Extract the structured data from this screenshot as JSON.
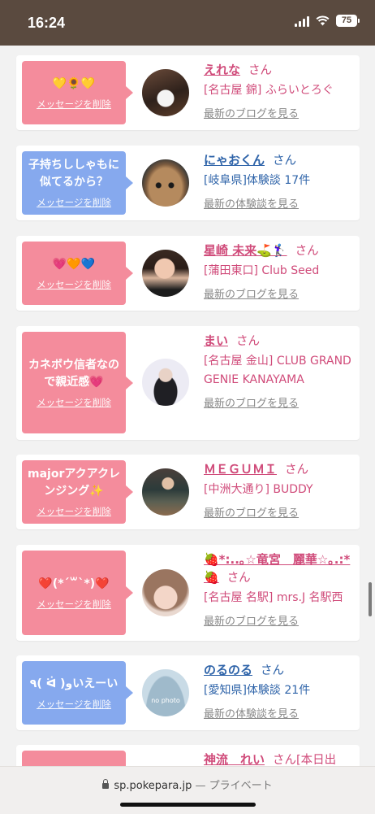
{
  "status_bar": {
    "time": "16:24",
    "battery": "75"
  },
  "entries": [
    {
      "message": "💛🌻💛",
      "delete_label": "メッセージを削除",
      "bubble_color": "pink",
      "name": "えれな",
      "suffix": "さん",
      "store": "[名古屋 錦] ふらいとろぐ",
      "link": "最新のブログを見る",
      "name_color": "pink"
    },
    {
      "message": "子持ちししゃもに似てるから？",
      "delete_label": "メッセージを削除",
      "bubble_color": "blue",
      "name": "にゃおくん",
      "suffix": "さん",
      "store": "[岐阜県]体験談 17件",
      "link": "最新の体験談を見る",
      "name_color": "blue"
    },
    {
      "message": "💗🧡💙",
      "delete_label": "メッセージを削除",
      "bubble_color": "pink",
      "name": "星崎 未来⛳️🏌️‍♀️",
      "suffix": "さん",
      "store": "[蒲田東口] Club Seed",
      "link": "最新のブログを見る",
      "name_color": "pink"
    },
    {
      "message": "カネボウ信者なので親近感💗",
      "delete_label": "メッセージを削除",
      "bubble_color": "pink",
      "name": "まい",
      "suffix": "さん",
      "store": "[名古屋 金山] CLUB GRAND GENIE KANAYAMA",
      "link": "最新のブログを見る",
      "name_color": "pink"
    },
    {
      "message": "majorアクアクレンジング✨",
      "delete_label": "メッセージを削除",
      "bubble_color": "pink",
      "name": "ＭＥＧＵＭＩ",
      "suffix": "さん",
      "store": "[中洲大通り] BUDDY",
      "link": "最新のブログを見る",
      "name_color": "pink"
    },
    {
      "message": "❤️(*´꒳`*)❤️",
      "delete_label": "メッセージを削除",
      "bubble_color": "pink",
      "name": "🍓*:..｡☆竜宮　麗華☆｡.:*🍓",
      "suffix": "さん",
      "store": "[名古屋 名駅] mrs.J 名駅西",
      "link": "最新のブログを見る",
      "name_color": "pink"
    },
    {
      "message": "٩( ᐛ )وいえーい",
      "delete_label": "メッセージを削除",
      "bubble_color": "blue",
      "name": "のるのる",
      "suffix": "さん",
      "store": "[愛知県]体験談 21件",
      "link": "最新の体験談を見る",
      "name_color": "blue",
      "avatar_text": "no photo"
    },
    {
      "message": "",
      "delete_label": "",
      "bubble_color": "pink",
      "name": "神流　れい",
      "suffix": "さん[本日出",
      "store": "",
      "link": "",
      "name_color": "pink"
    }
  ],
  "browser": {
    "url": "sp.pokepara.jp",
    "separator": "—",
    "mode": "プライベート"
  }
}
